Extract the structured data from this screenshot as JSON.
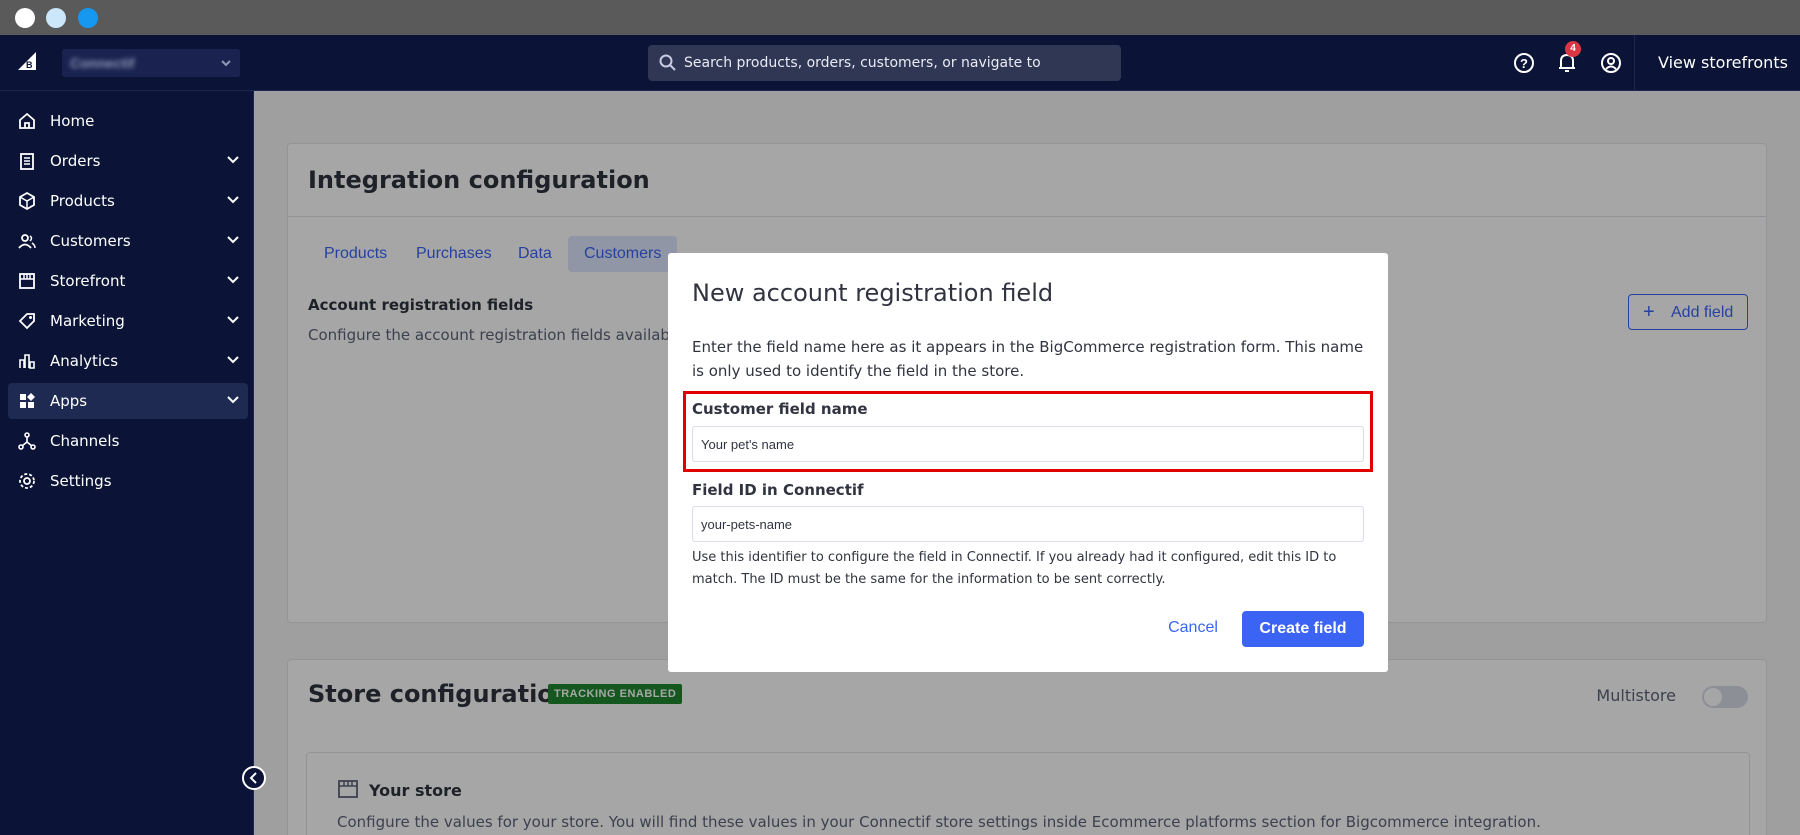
{
  "topbar": {
    "store_name": "Connectif",
    "search_placeholder": "Search products, orders, customers, or navigate to",
    "notifications_count": "4",
    "view_storefronts": "View storefronts"
  },
  "sidebar": {
    "items": [
      {
        "label": "Home",
        "icon": "home-icon",
        "expandable": false
      },
      {
        "label": "Orders",
        "icon": "orders-icon",
        "expandable": true
      },
      {
        "label": "Products",
        "icon": "products-icon",
        "expandable": true
      },
      {
        "label": "Customers",
        "icon": "customers-icon",
        "expandable": true
      },
      {
        "label": "Storefront",
        "icon": "storefront-icon",
        "expandable": true
      },
      {
        "label": "Marketing",
        "icon": "marketing-icon",
        "expandable": true
      },
      {
        "label": "Analytics",
        "icon": "analytics-icon",
        "expandable": true
      },
      {
        "label": "Apps",
        "icon": "apps-icon",
        "expandable": true,
        "active": true
      },
      {
        "label": "Channels",
        "icon": "channels-icon",
        "expandable": false
      },
      {
        "label": "Settings",
        "icon": "settings-icon",
        "expandable": false
      }
    ]
  },
  "integration": {
    "title": "Integration configuration",
    "tabs": [
      "Products",
      "Purchases",
      "Data",
      "Customers"
    ],
    "selected_tab": "Customers",
    "section_title": "Account registration fields",
    "section_desc": "Configure the account registration fields available i",
    "add_field": "Add field"
  },
  "store": {
    "title": "Store configuration",
    "badge": "TRACKING ENABLED",
    "multistore": "Multistore",
    "your_store": "Your store",
    "your_store_desc": "Configure the values for your store. You will find these values in your Connectif store settings inside Ecommerce platforms section for Bigcommerce integration."
  },
  "modal": {
    "title": "New account registration field",
    "description": "Enter the field name here as it appears in the BigCommerce registration form. This name is only used to identify the field in the store.",
    "customer_field_label": "Customer field name",
    "customer_field_value": "Your pet's name",
    "field_id_label": "Field ID in Connectif",
    "field_id_value": "your-pets-name",
    "help": "Use this identifier to configure the field in Connectif. If you already had it configured, edit this ID to match. The ID must be the same for the information to be sent correctly.",
    "cancel": "Cancel",
    "create": "Create field"
  },
  "colors": {
    "nav_bg": "#0b1437",
    "accent": "#3c64f4",
    "highlight": "#e00000",
    "tracking": "#208831"
  }
}
